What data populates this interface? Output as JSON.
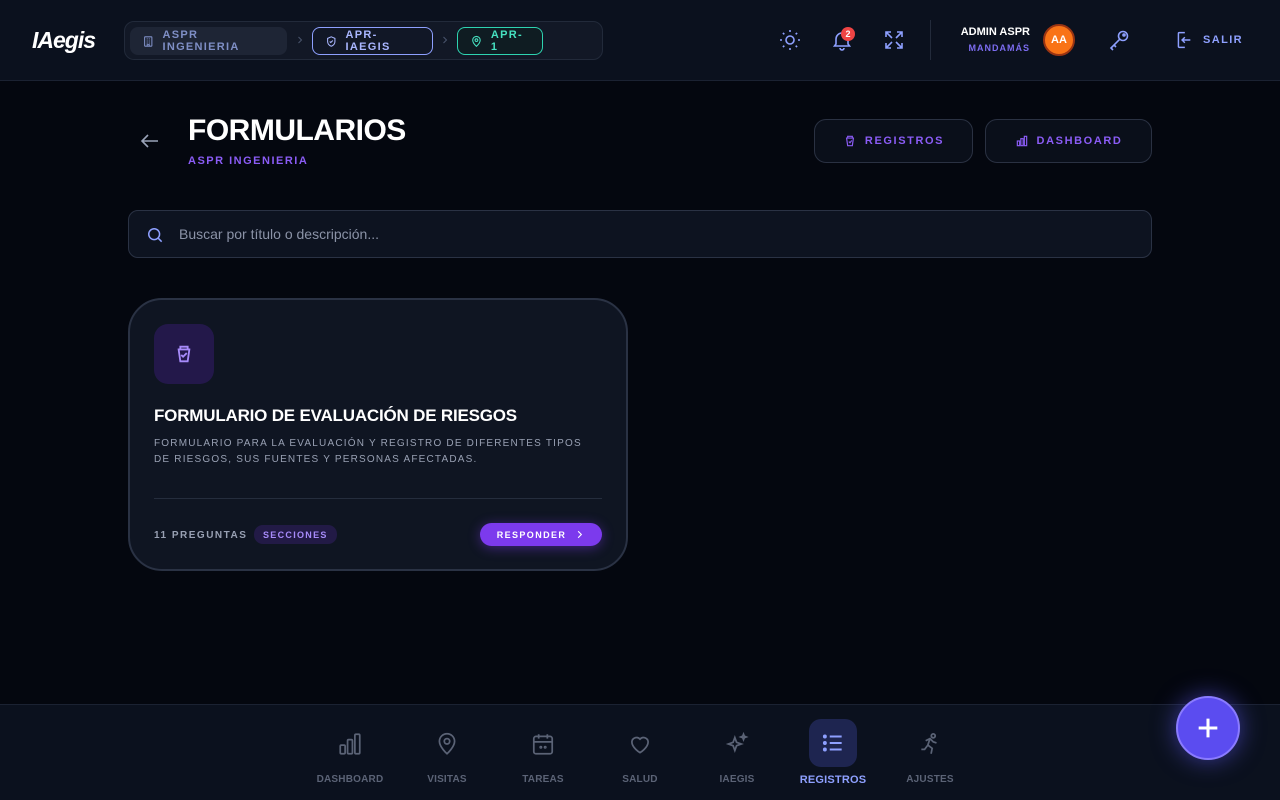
{
  "app": {
    "logo": "IAegis"
  },
  "breadcrumb": {
    "items": [
      {
        "label": "ASPR INGENIERIA",
        "icon": "building-icon"
      },
      {
        "label": "APR-IAEGIS",
        "icon": "shield-icon"
      },
      {
        "label": "APR-1",
        "icon": "map-pin-icon"
      }
    ]
  },
  "topbar": {
    "notification_count": "2",
    "user_name": "ADMIN ASPR",
    "user_role": "MANDAMÁS",
    "avatar_initials": "AA",
    "logout_label": "SALIR"
  },
  "header": {
    "title": "FORMULARIOS",
    "subtitle": "ASPR INGENIERIA",
    "registros_label": "REGISTROS",
    "dashboard_label": "DASHBOARD"
  },
  "search": {
    "placeholder": "Buscar por título o descripción...",
    "value": ""
  },
  "forms": [
    {
      "title": "FORMULARIO DE EVALUACIÓN DE RIESGOS",
      "description": "FORMULARIO PARA LA EVALUACIÓN Y REGISTRO DE DIFERENTES TIPOS DE RIESGOS, SUS FUENTES Y PERSONAS AFECTADAS.",
      "questions": "11 PREGUNTAS",
      "tag": "SECCIONES",
      "action_label": "RESPONDER"
    }
  ],
  "bottom_nav": {
    "active": "REGISTROS",
    "items": [
      {
        "label": "DASHBOARD",
        "icon": "bar-chart-icon"
      },
      {
        "label": "VISITAS",
        "icon": "map-pin-icon"
      },
      {
        "label": "TAREAS",
        "icon": "calendar-icon"
      },
      {
        "label": "SALUD",
        "icon": "heart-icon"
      },
      {
        "label": "IAEGIS",
        "icon": "sparkles-icon"
      },
      {
        "label": "REGISTROS",
        "icon": "list-icon"
      },
      {
        "label": "AJUSTES",
        "icon": "runner-icon"
      }
    ]
  },
  "colors": {
    "accent": "#8b5cf6",
    "primary_blue": "#8ea0ff",
    "teal": "#2ed3b0",
    "avatar": "#f97316",
    "background": "#04070f"
  }
}
